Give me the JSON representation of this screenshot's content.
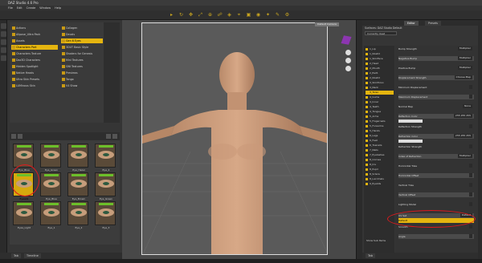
{
  "window": {
    "title": "DAZ Studio 4.6 Pro"
  },
  "menu": [
    "File",
    "Edit",
    "Create",
    "Window",
    "Help"
  ],
  "left_panel": {
    "categories_col1": [
      {
        "label": "Actions",
        "selected": false
      },
      {
        "label": "Allpose_Ultra Pack",
        "selected": false
      },
      {
        "label": "Assets",
        "selected": false
      },
      {
        "label": "Characters Part",
        "selected": true
      },
      {
        "label": "Characters Texture",
        "selected": false
      },
      {
        "label": "Daz3D Characters",
        "selected": false
      },
      {
        "label": "Hidden Spotlight",
        "selected": false
      },
      {
        "label": "Native Heads",
        "selected": false
      },
      {
        "label": "Ultra Skin Presets",
        "selected": false
      },
      {
        "label": "LUMinous Skin",
        "selected": false
      }
    ],
    "categories_col2": [
      {
        "label": "Collagen",
        "selected": false
      },
      {
        "label": "Decals",
        "selected": false
      },
      {
        "label": "Gen 6 Eyes",
        "selected": true
      },
      {
        "label": "3DUT Basic Style",
        "selected": false
      },
      {
        "label": "Shaders for Genesis",
        "selected": false
      },
      {
        "label": "Mini Textures",
        "selected": false
      },
      {
        "label": "GNI Textures",
        "selected": false
      },
      {
        "label": "Previews",
        "selected": false
      },
      {
        "label": "Tango",
        "selected": false
      },
      {
        "label": "V4 Show",
        "selected": false
      }
    ],
    "thumbnails": [
      {
        "caption": "Eye_Blue",
        "selected": false
      },
      {
        "caption": "Eye_Green",
        "selected": false
      },
      {
        "caption": "Eye_Hazel",
        "selected": false
      },
      {
        "caption": "Eyes01",
        "selected": true
      },
      {
        "caption": "Eye_Blue",
        "selected": false
      },
      {
        "caption": "Eye_Brown",
        "selected": false
      },
      {
        "caption": "Eye_Green",
        "selected": false
      },
      {
        "caption": "Eyes_Light",
        "selected": false
      },
      {
        "caption": "Eye_1",
        "selected": false
      },
      {
        "caption": "Eye_2",
        "selected": false
      },
      {
        "caption": "Eye_3",
        "selected": false
      },
      {
        "caption": "Eye_4",
        "selected": false
      }
    ],
    "bottom_tabs": [
      "Tab",
      "Timeline"
    ]
  },
  "viewport": {
    "frame_label": "Default Camera"
  },
  "right_panel": {
    "tabs": [
      "Editor",
      "Presets"
    ],
    "active_tab": "Editor",
    "subtitle": "Surfaces: DAZ Studio Default",
    "dropdown": "Currently Used",
    "surfaces": [
      "1_Lip",
      "1_Nostril",
      "1_SkinFace",
      "2_Head",
      "2_Mouth",
      "2_EarR",
      "2_Nostril",
      "3_SkinTorso",
      "3_Neck",
      "3_Torso",
      "4_Gums",
      "4_Inner",
      "4_Teeth",
      "4_Tongue",
      "5_Arms",
      "5_Fingernails",
      "5_Forearms",
      "5_Hands",
      "6_Legs",
      "6_Feet",
      "6_Toenails",
      "7_Nails",
      "7_Eyelashes",
      "8_Cornea",
      "8_Iris",
      "8_Pupil",
      "8_Sclera",
      "8_Lacrimals",
      "9_Eyelids"
    ],
    "selected_surface": "3_Torso",
    "properties": [
      {
        "label": "Bump Strength",
        "value": "Multiplier"
      },
      {
        "label": "Negative Bump",
        "value": "Multiplier"
      },
      {
        "label": "Positive Bump",
        "value": "Multiplier"
      },
      {
        "label": "Displacement Strength",
        "value": "Choose Map"
      },
      {
        "label": "Minimum Displacement",
        "value": ""
      },
      {
        "label": "Maximum Displacement",
        "value": ""
      },
      {
        "label": "Normal Map",
        "value": "None"
      },
      {
        "label": "Reflection Color",
        "value": "255 255 255"
      },
      {
        "label": "Reflection Strength",
        "value": ""
      },
      {
        "label": "Refraction Color",
        "value": "255 255 255"
      },
      {
        "label": "Refraction Strength",
        "value": ""
      },
      {
        "label": "Index of Refraction",
        "value": "Multiplier"
      },
      {
        "label": "Horizontal Tiles",
        "value": ""
      },
      {
        "label": "Horizontal Offset",
        "value": ""
      },
      {
        "label": "Vertical Tiles",
        "value": ""
      },
      {
        "label": "Vertical Offset",
        "value": ""
      },
      {
        "label": "Lighting Model",
        "value": ""
      },
      {
        "label": "UV Set",
        "value": "Default"
      },
      {
        "label": "Smooth",
        "value": ""
      },
      {
        "label": "Angle",
        "value": ""
      }
    ],
    "show_sub_items": "Show Sub Items",
    "bottom_tab": "Tab"
  }
}
